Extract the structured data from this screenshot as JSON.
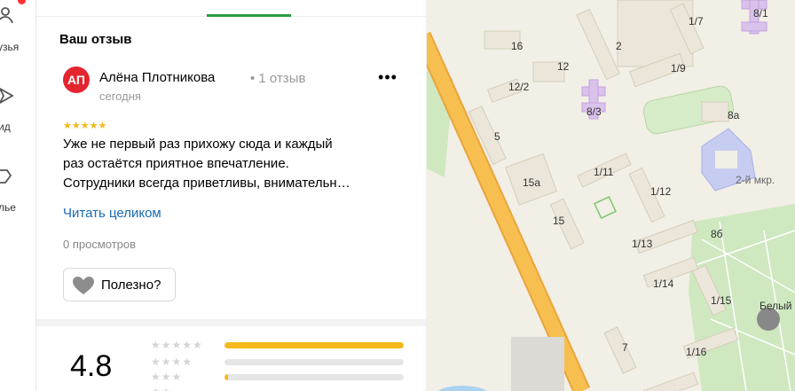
{
  "left_sidebar": {
    "items": [
      {
        "label": "узья",
        "icon": "friends-icon"
      },
      {
        "label": "ид",
        "icon": "guide-icon"
      },
      {
        "label": "лье",
        "icon": "atelier-icon"
      }
    ]
  },
  "review_section": {
    "title": "Ваш отзыв",
    "author": {
      "initials": "АП",
      "name": "Алёна Плотникова",
      "reviews_count": "• 1 отзыв",
      "date": "сегодня"
    },
    "more_label": "•••",
    "stars": "★★★★★",
    "rating": 5,
    "text_lines": [
      "Уже не первый раз прихожу сюда и каждый",
      "раз остаётся приятное впечатление.",
      "Сотрудники всегда приветливы, внимательн…"
    ],
    "read_more": "Читать целиком",
    "views": "0 просмотров",
    "helpful_label": "Полезно?"
  },
  "rating_summary": {
    "value": "4.8",
    "rows": [
      {
        "stars": "★★★★★",
        "fill": 1.0
      },
      {
        "stars": "★★★★",
        "fill": 0.0
      },
      {
        "stars": "★★★",
        "fill": 0.02
      },
      {
        "stars": "★★",
        "fill": 0.0
      }
    ]
  },
  "map": {
    "labels": [
      "8/1",
      "1/7",
      "16",
      "2",
      "12",
      "12/2",
      "1/9",
      "8/3",
      "8а",
      "5",
      "2-й мкр.",
      "1/11",
      "15а",
      "1/12",
      "15",
      "8б",
      "1/13",
      "1/14",
      "1/15",
      "Белый",
      "7",
      "1/16"
    ],
    "colors": {
      "road": "#f5b53d",
      "building": "#ebe6d9",
      "purple": "#d9c2ec",
      "green": "#cfe8c0"
    }
  }
}
